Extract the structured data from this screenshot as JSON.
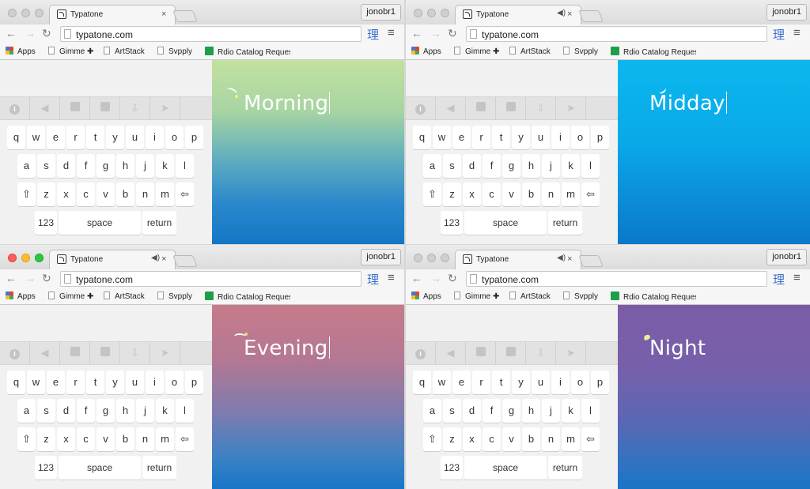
{
  "windows": [
    {
      "tab_title": "Typatone",
      "tab_close": "×",
      "user": "jonobr1",
      "url": "typatone.com",
      "word": "Morning"
    },
    {
      "tab_title": "Typatone",
      "tab_close": "×",
      "user": "jonobr1",
      "url": "typatone.com",
      "word": "Midday"
    },
    {
      "tab_title": "Typatone",
      "tab_close": "×",
      "user": "jonobr1",
      "url": "typatone.com",
      "word": "Evening"
    },
    {
      "tab_title": "Typatone",
      "tab_close": "×",
      "user": "jonobr1",
      "url": "typatone.com",
      "word": "Night"
    }
  ],
  "toolbar": {
    "back": "←",
    "forward": "→",
    "reload": "↻",
    "extension": "理",
    "menu": "≡",
    "audio": "◀)"
  },
  "bookmarks": [
    "Apps",
    "Gimme ✚",
    "ArtStack",
    "Svpply",
    "Rdio Catalog Reques"
  ],
  "keyboard": {
    "toolbar_icons": [
      "info-icon",
      "mute-icon",
      "screenshot-icon",
      "clipboard-icon",
      "download-icon",
      "send-icon"
    ],
    "row1": [
      "q",
      "w",
      "e",
      "r",
      "t",
      "y",
      "u",
      "i",
      "o",
      "p"
    ],
    "row2": [
      "a",
      "s",
      "d",
      "f",
      "g",
      "h",
      "j",
      "k",
      "l"
    ],
    "row3": [
      "⇧",
      "z",
      "x",
      "c",
      "v",
      "b",
      "n",
      "m",
      "⇦"
    ],
    "num_label": "123",
    "space_label": "space",
    "return_label": "return"
  }
}
